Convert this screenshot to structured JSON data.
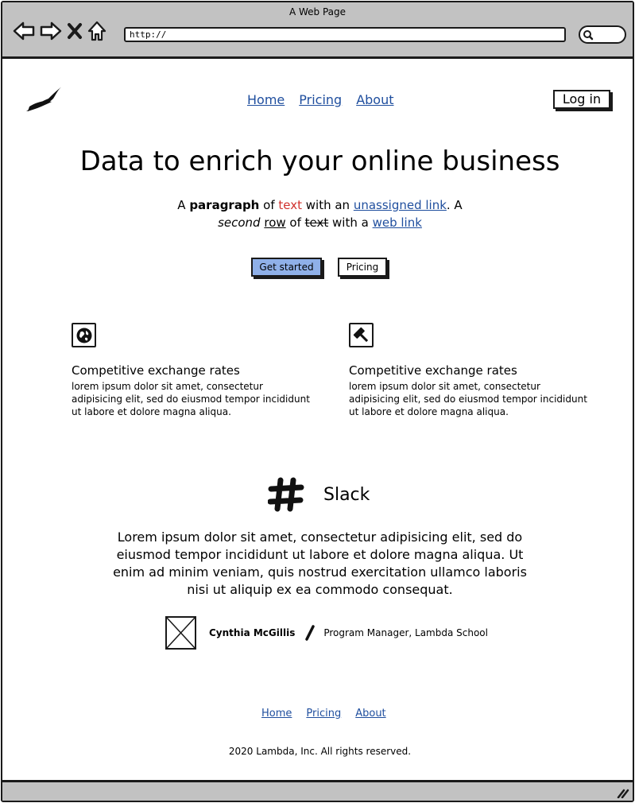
{
  "window": {
    "title": "A Web Page",
    "url": "http://"
  },
  "nav": {
    "items": [
      "Home",
      "Pricing",
      "About"
    ],
    "login_label": "Log in"
  },
  "hero": {
    "title": "Data to enrich your online business",
    "para": {
      "t1": "A ",
      "bold": "paragraph",
      "t2": " of ",
      "red": "text",
      "t3": " with an ",
      "link1": "unassigned link",
      "t4": ". A",
      "italic": "second",
      "t5": " ",
      "underline": "row",
      "t6": " of ",
      "strike": "text",
      "t7": " with a ",
      "link2": "web link"
    },
    "primary_button": "Get started",
    "secondary_button": "Pricing"
  },
  "features": [
    {
      "icon": "globe-icon",
      "title": "Competitive exchange rates",
      "body": "lorem ipsum dolor sit amet, consectetur adipisicing elit, sed do eiusmod tempor incididunt ut labore et dolore magna aliqua."
    },
    {
      "icon": "gavel-icon",
      "title": "Competitive exchange rates",
      "body": "lorem ipsum dolor sit amet, consectetur adipisicing elit, sed do eiusmod tempor incididunt ut labore et dolore magna aliqua."
    }
  ],
  "testimonial": {
    "brand": "Slack",
    "quote": "Lorem ipsum dolor sit amet, consectetur adipisicing elit, sed do eiusmod tempor incididunt ut labore et dolore magna aliqua. Ut enim ad minim veniam, quis nostrud exercitation ullamco laboris nisi ut aliquip ex ea commodo consequat.",
    "name": "Cynthia McGillis",
    "role": "Program Manager, Lambda School"
  },
  "footer": {
    "items": [
      "Home",
      "Pricing",
      "About"
    ],
    "copyright": "2020 Lambda, Inc. All rights reserved."
  },
  "colors": {
    "chrome": "#c2c2c2",
    "link": "#1f4e9e",
    "primary_button": "#8fb0e8",
    "accent_red": "#d0312d"
  }
}
